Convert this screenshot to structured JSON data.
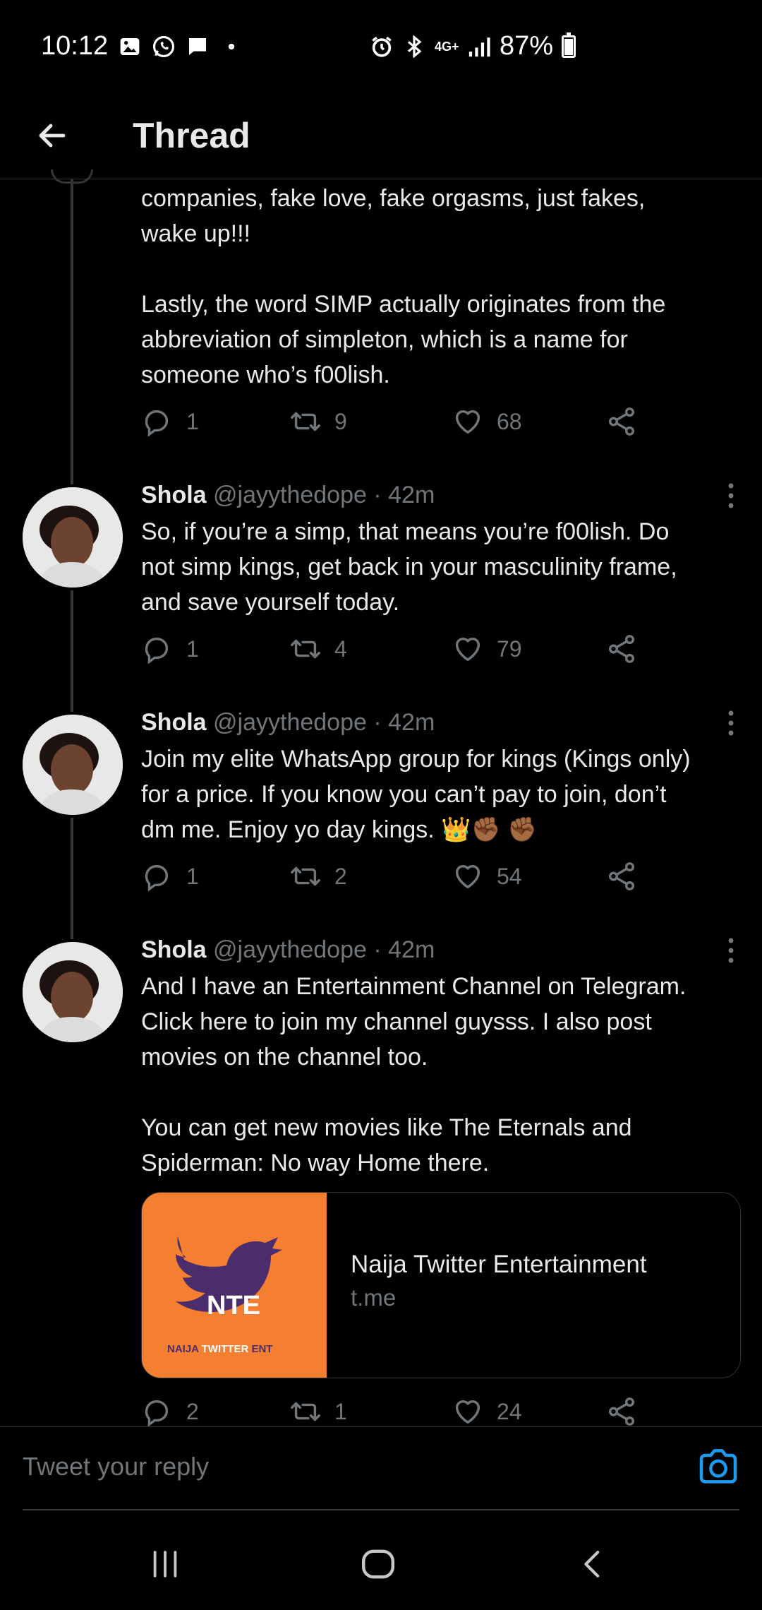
{
  "status_bar": {
    "time": "10:12",
    "network": "4G+",
    "battery": "87%",
    "battery_level": 0.87,
    "left_icons": [
      "gallery-icon",
      "whatsapp-icon",
      "message-icon",
      "dot-icon"
    ],
    "right_icons": [
      "alarm-icon",
      "bluetooth-icon",
      "network-4g-icon",
      "signal-icon",
      "battery-icon"
    ]
  },
  "header": {
    "title": "Thread",
    "back_icon": "arrow-left-icon"
  },
  "tweets": [
    {
      "text": "companies, fake love, fake orgasms, just fakes,\nwake up!!!\n\nLastly, the word SIMP actually originates from the\nabbreviation of simpleton, which is a name for\nsomeone who’s f00lish.",
      "replies": "1",
      "retweets": "9",
      "likes": "68"
    },
    {
      "name": "Shola",
      "handle": "@jayythedope",
      "time": "· 42m",
      "text": "So, if you’re a simp, that means you’re f00lish. Do\nnot simp kings, get back in your masculinity frame,\nand save yourself today.",
      "replies": "1",
      "retweets": "4",
      "likes": "79"
    },
    {
      "name": "Shola",
      "handle": "@jayythedope",
      "time": "· 42m",
      "text": "Join my elite WhatsApp group for kings (Kings only)\nfor a price. If you know you can’t pay to join, don’t\ndm me. Enjoy yo day kings. 👑✊🏾 ✊🏾",
      "replies": "1",
      "retweets": "2",
      "likes": "54"
    },
    {
      "name": "Shola",
      "handle": "@jayythedope",
      "time": "· 42m",
      "text": "And I have an Entertainment Channel on Telegram.\nClick here to join my channel guysss. I also post\nmovies on the channel too.\n\nYou can get new movies like The Eternals and\nSpiderman: No way Home there.",
      "replies": "2",
      "retweets": "1",
      "likes": "24",
      "card": {
        "title": "Naija Twitter Entertainment",
        "domain": "t.me",
        "logo_letters": "NTE",
        "logo_caption_1": "NAIJA",
        "logo_caption_2": "TWITTER",
        "logo_caption_3": "ENT",
        "bg_color": "#f47f31"
      }
    }
  ],
  "reply": {
    "placeholder": "Tweet your reply"
  },
  "colors": {
    "background": "#000000",
    "text": "#e7e9ea",
    "muted": "#71767b",
    "accent": "#1d9bf0"
  }
}
